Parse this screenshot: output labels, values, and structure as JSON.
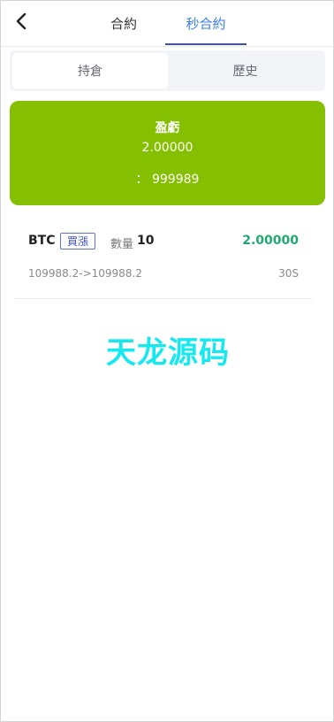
{
  "header": {
    "tabs": [
      {
        "label": "合約",
        "active": false
      },
      {
        "label": "秒合約",
        "active": true
      }
    ]
  },
  "segment": {
    "items": [
      {
        "label": "持倉",
        "active": true
      },
      {
        "label": "歷史",
        "active": false
      }
    ]
  },
  "summary": {
    "title": "盈虧",
    "value": "2.00000",
    "balance": "： 999989"
  },
  "orders": [
    {
      "symbol": "BTC",
      "direction": "買漲",
      "qty_label": "數量",
      "qty": "10",
      "profit": "2.00000",
      "prices": "109988.2->109988.2",
      "duration": "30S"
    }
  ],
  "watermark": "天龙源码",
  "colors": {
    "card_green": "#85c000",
    "accent_blue": "#3b7de8",
    "profit_green": "#1fa96f",
    "watermark_cyan": "#16e8f0"
  }
}
